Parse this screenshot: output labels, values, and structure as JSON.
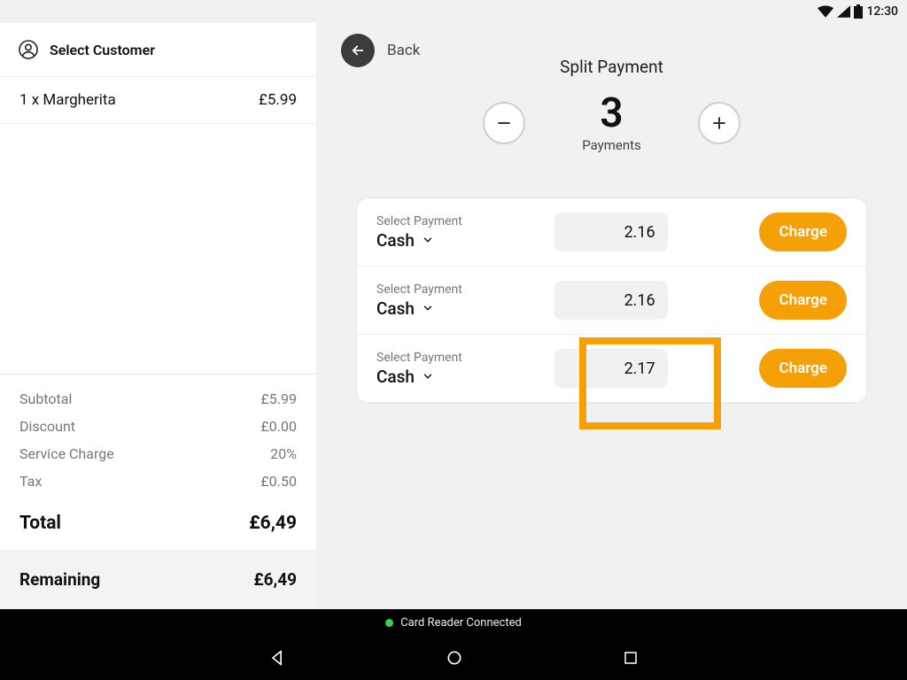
{
  "status": {
    "time": "12:30"
  },
  "sidebar": {
    "customer_label": "Select Customer",
    "items": [
      {
        "line": "1 x Margherita",
        "price": "£5.99"
      }
    ],
    "subtotal": {
      "label": "Subtotal",
      "value": "£5.99"
    },
    "discount": {
      "label": "Discount",
      "value": "£0.00"
    },
    "service": {
      "label": "Service Charge",
      "value": "20%"
    },
    "tax": {
      "label": "Tax",
      "value": "£0.50"
    },
    "total": {
      "label": "Total",
      "value": "£6,49"
    },
    "remaining": {
      "label": "Remaining",
      "value": "£6,49"
    }
  },
  "main": {
    "back_label": "Back",
    "split_title": "Split Payment",
    "count": "3",
    "count_label": "Payments",
    "rows": [
      {
        "label": "Select Payment",
        "method": "Cash",
        "amount": "2.16",
        "charge": "Charge"
      },
      {
        "label": "Select Payment",
        "method": "Cash",
        "amount": "2.16",
        "charge": "Charge"
      },
      {
        "label": "Select Payment",
        "method": "Cash",
        "amount": "2.17",
        "charge": "Charge"
      }
    ]
  },
  "footer": {
    "reader": "Card Reader Connected"
  }
}
